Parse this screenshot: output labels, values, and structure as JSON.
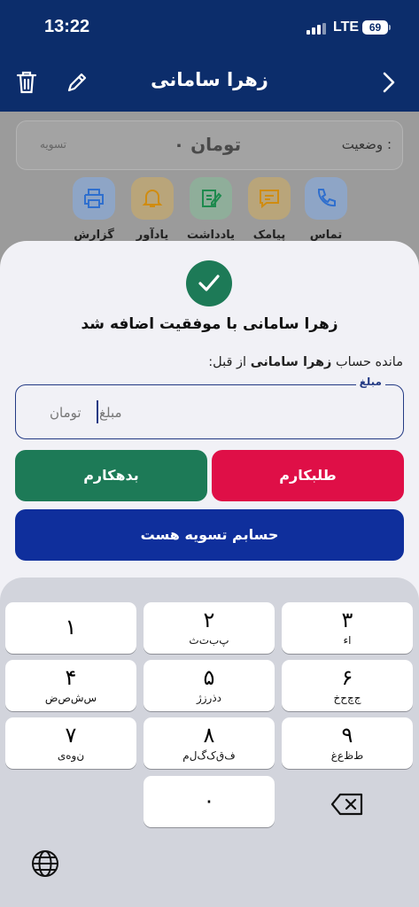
{
  "status_bar": {
    "time": "13:22",
    "network": "LTE",
    "battery": "69"
  },
  "header": {
    "title": "زهرا سامانی"
  },
  "account": {
    "status_label": "وضعیت :",
    "balance": "۰ تومان",
    "settle_tag": "تسویه"
  },
  "actions": [
    {
      "label": "تماس",
      "icon": "phone-icon",
      "color": "#2f7fe0"
    },
    {
      "label": "پیامک",
      "icon": "message-icon",
      "color": "#e6a31c"
    },
    {
      "label": "یادداشت",
      "icon": "note-icon",
      "color": "#28a060"
    },
    {
      "label": "یادآور",
      "icon": "bell-icon",
      "color": "#e6a31c"
    },
    {
      "label": "گزارش",
      "icon": "printer-icon",
      "color": "#2f7fe0"
    }
  ],
  "sheet": {
    "success_message": "زهرا سامانی با موفقیت اضافه شد",
    "balance_prefix": "مانده حساب",
    "balance_name": "زهرا سامانی",
    "balance_suffix": "از قبل:",
    "amount_label": "مبلغ",
    "amount_placeholder": "مبلغ",
    "amount_unit": "تومان",
    "debtor_button": "بدهکارم",
    "creditor_button": "طلبکارم",
    "settled_button": "حسابم تسویه هست"
  },
  "keyboard": {
    "keys": [
      {
        "digit": "۱",
        "sub": ""
      },
      {
        "digit": "۲",
        "sub": "پ‌ب‌ت‌ث"
      },
      {
        "digit": "۳",
        "sub": "ا‌ء"
      },
      {
        "digit": "۴",
        "sub": "س‌ش‌ص‌ض"
      },
      {
        "digit": "۵",
        "sub": "د‌ذ‌ر‌ز‌ژ"
      },
      {
        "digit": "۶",
        "sub": "ج‌چ‌ح‌خ"
      },
      {
        "digit": "۷",
        "sub": "ن‌و‌ه‌ی"
      },
      {
        "digit": "۸",
        "sub": "ف‌ق‌ک‌گ‌ل‌م"
      },
      {
        "digit": "۹",
        "sub": "ط‌ظ‌ع‌غ"
      },
      {
        "digit": "۰",
        "sub": ""
      }
    ]
  },
  "colors": {
    "header": "#0c2d6b",
    "success": "#1d7a57",
    "danger": "#df0f47",
    "primary": "#0f2f9c"
  }
}
